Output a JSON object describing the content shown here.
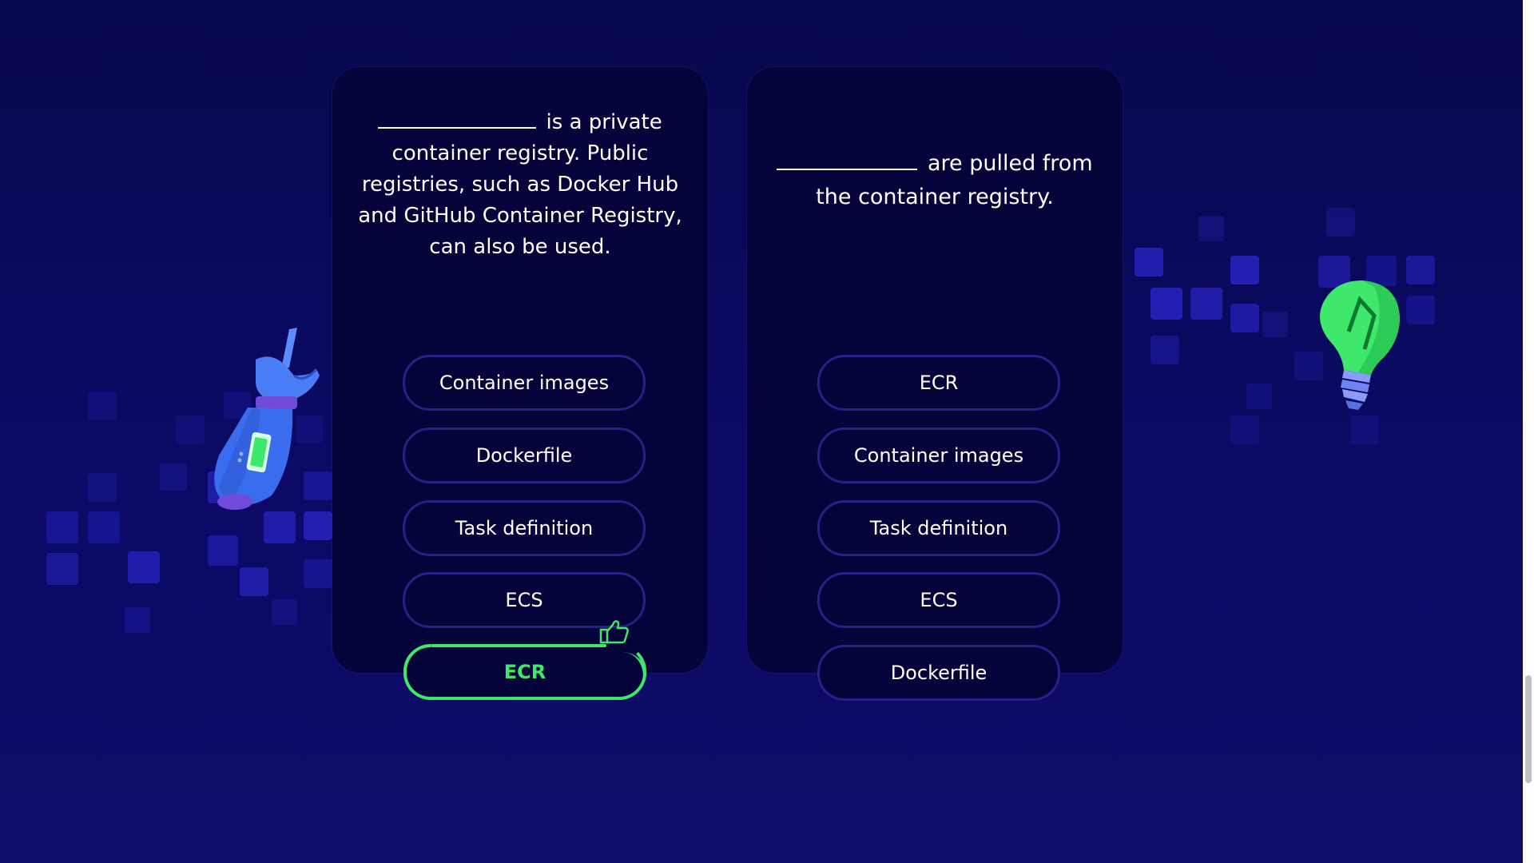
{
  "quiz": {
    "cards": [
      {
        "question_suffix": "is a private container registry. Public registries, such as Docker Hub and GitHub Container Registry, can also be used.",
        "options": [
          "Container images",
          "Dockerfile",
          "Task definition",
          "ECS",
          "ECR"
        ],
        "selected_correct_option": "ECR"
      },
      {
        "question_suffix": "are pulled from the container registry.",
        "options": [
          "ECR",
          "Container images",
          "Task definition",
          "ECS",
          "Dockerfile"
        ]
      }
    ]
  },
  "icons": {
    "robot_arm": "robot-arm-pointing-icon",
    "light_bulb": "light-bulb-icon",
    "thumbs_up": "thumbs-up-icon"
  },
  "colors": {
    "background": "#0a0a5c",
    "card": "#04043a",
    "option_border": "#2a1f86",
    "correct": "#3ee86a",
    "text": "#ffffff"
  }
}
